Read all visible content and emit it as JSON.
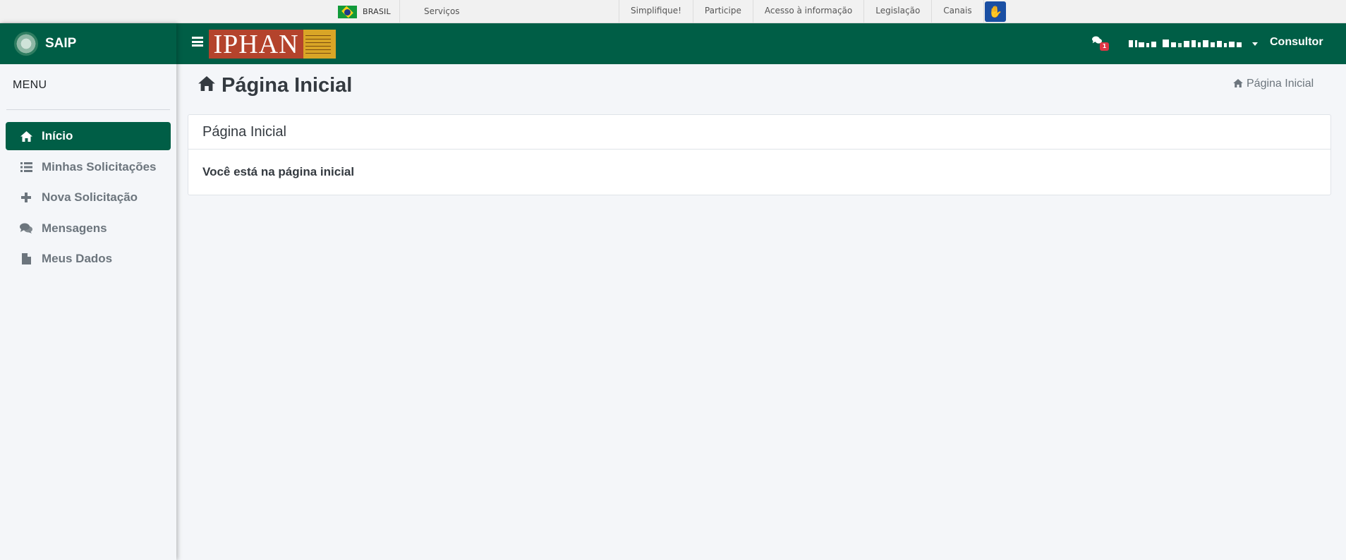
{
  "govbar": {
    "country_label": "BRASIL",
    "services_label": "Serviços",
    "links": [
      "Simplifique!",
      "Participe",
      "Acesso à informação",
      "Legislação",
      "Canais"
    ]
  },
  "sidebar": {
    "brand_name": "SAIP",
    "menu_title": "MENU",
    "items": [
      {
        "label": "Início",
        "icon": "home-icon",
        "active": true
      },
      {
        "label": "Minhas Solicitações",
        "icon": "list-icon",
        "active": false
      },
      {
        "label": "Nova Solicitação",
        "icon": "plus-icon",
        "active": false
      },
      {
        "label": "Mensagens",
        "icon": "comments-icon",
        "active": false
      },
      {
        "label": "Meus Dados",
        "icon": "file-icon",
        "active": false
      }
    ]
  },
  "navbar": {
    "logo_text": "IPHAN",
    "messages_badge": "1",
    "user_name": "",
    "role": "Consultor"
  },
  "content": {
    "page_title": "Página Inicial",
    "breadcrumb": "Página Inicial",
    "card_title": "Página Inicial",
    "card_text": "Você está na página inicial"
  },
  "colors": {
    "primary": "#005e46",
    "logo_red": "#b4432c",
    "logo_gold": "#d9a526",
    "badge": "#dc3545"
  }
}
